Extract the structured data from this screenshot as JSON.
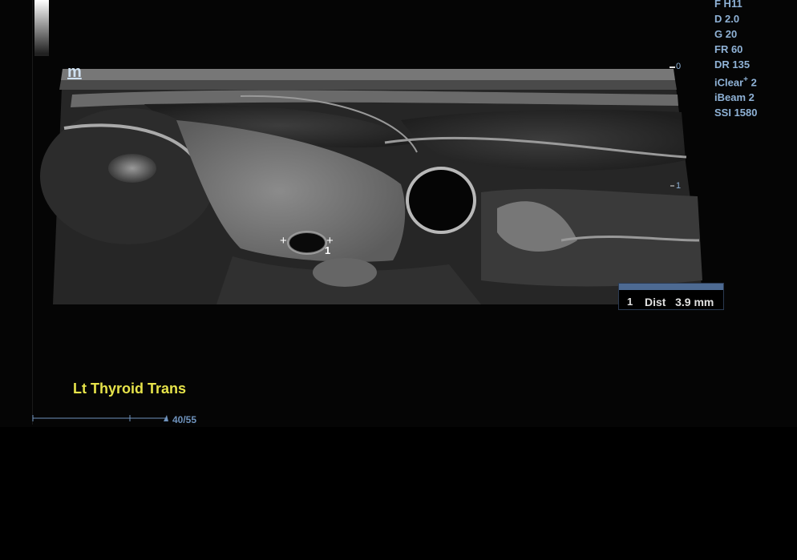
{
  "params": {
    "top_cut": "F H11",
    "d": "D 2.0",
    "g": "G 20",
    "fr": "FR 60",
    "dr": "DR 135",
    "iclear_label": "iClear",
    "iclear_sup": "+",
    "iclear_value": "2",
    "ibeam": "iBeam 2",
    "ssi": "SSI 1580"
  },
  "logo": "m",
  "depth_marks": {
    "zero": "0",
    "one": "1"
  },
  "image_label": "Lt Thyroid Trans",
  "measurement": {
    "index": "1",
    "label": "Dist",
    "value": "3.9 mm"
  },
  "caliper": {
    "index": "1"
  },
  "frame_counter": "40/55"
}
